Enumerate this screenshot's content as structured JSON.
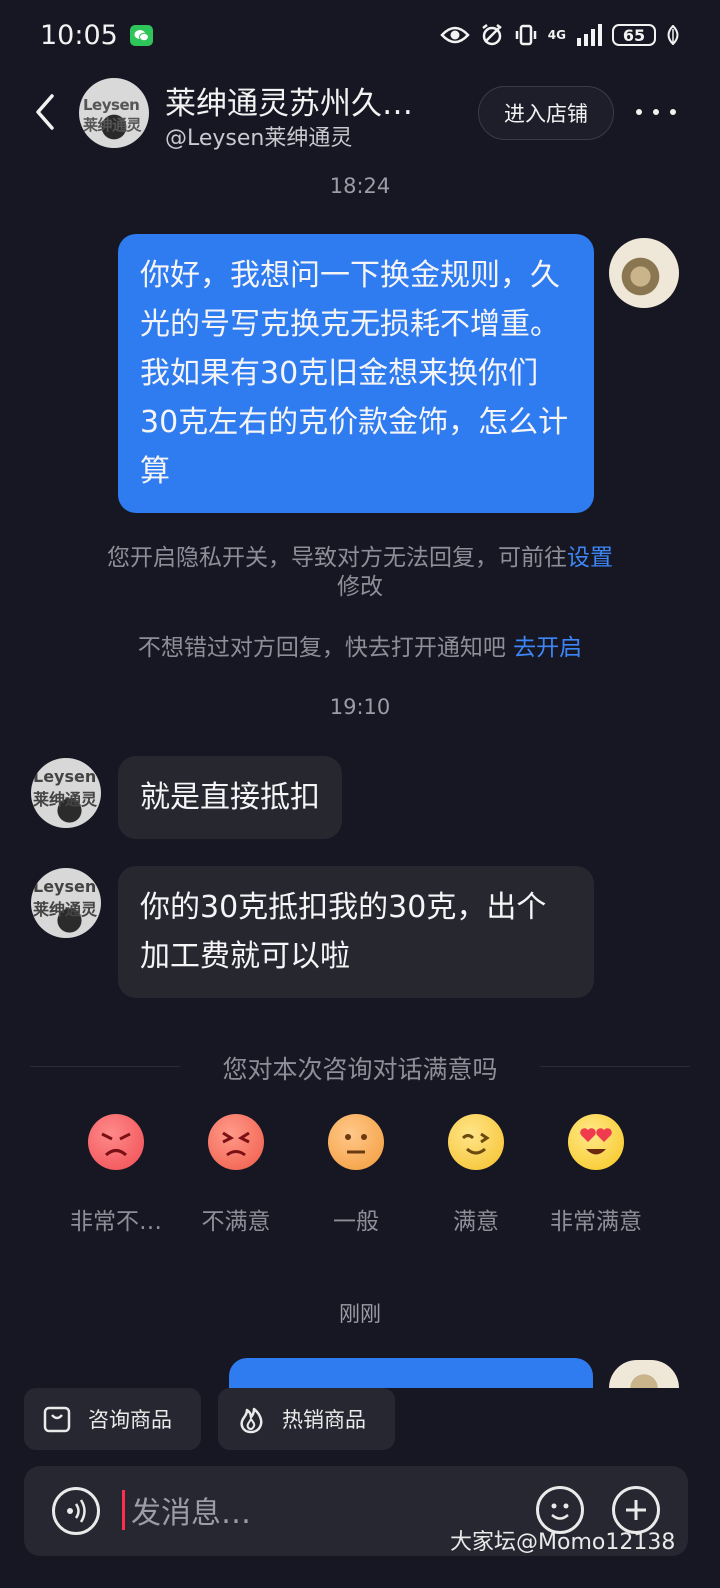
{
  "status_bar": {
    "time": "10:05",
    "network": "4G",
    "battery": "65"
  },
  "header": {
    "shop_name": "莱绅通灵苏州久…",
    "shop_handle": "@Leysen莱绅通灵",
    "avatar_text": "Leysen\n莱绅通灵",
    "enter_shop_label": "进入店铺"
  },
  "chat": {
    "time_1": "18:24",
    "my_message": "你好，我想问一下换金规则，久光的号写克换克无损耗不增重。我如果有30克旧金想来换你们30克左右的克价款金饰，怎么计算",
    "privacy_notice": "您开启隐私开关，导致对方无法回复，可前往",
    "privacy_link": "设置",
    "privacy_notice_tail": "修改",
    "notify_notice": "不想错过对方回复，快去打开通知吧 ",
    "notify_link": "去开启",
    "time_2": "19:10",
    "reply_1": "就是直接抵扣",
    "reply_2": "你的30克抵扣我的30克，出个加工费就可以啦",
    "time_3": "刚刚"
  },
  "rating": {
    "question": "您对本次咨询对话满意吗",
    "options": [
      "非常不…",
      "不满意",
      "一般",
      "满意",
      "非常满意"
    ],
    "colors": [
      "#ef4d52",
      "#f05a48",
      "#f39b3a",
      "#f5c02a",
      "#f7c51e"
    ]
  },
  "toolbar": {
    "consult_label": "咨询商品",
    "hot_label": "热销商品"
  },
  "input": {
    "placeholder": "发消息…"
  },
  "watermark": "大家坛@Momo12138"
}
